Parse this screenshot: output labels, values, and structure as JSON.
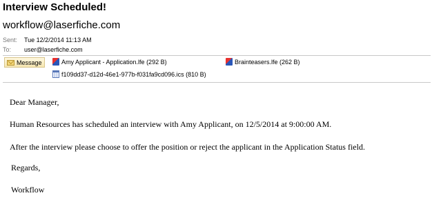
{
  "header": {
    "subject": "Interview Scheduled!",
    "sender": "workflow@laserfiche.com",
    "sent_label": "Sent:",
    "sent_value": "Tue 12/2/2014 11:13 AM",
    "to_label": "To:",
    "to_value": "user@laserfiche.com"
  },
  "attachments_bar": {
    "message_tab_label": "Message",
    "message_tab_icon": "envelope-icon",
    "items": [
      {
        "label": "Amy Applicant - Application.lfe (292 B)",
        "icon": "laserfiche-file-icon"
      },
      {
        "label": "Brainteasers.lfe (262 B)",
        "icon": "laserfiche-file-icon"
      },
      {
        "label": "f109dd37-d12d-46e1-977b-f031fa9cd096.ics (810 B)",
        "icon": "calendar-file-icon"
      }
    ]
  },
  "body": {
    "greeting": "Dear Manager,",
    "paragraph1": "Human Resources has scheduled an interview with Amy Applicant, on 12/5/2014 at 9:00:00 AM.",
    "paragraph2": "After the interview please choose to offer the position or reject the applicant in the Application Status field.",
    "closing": "Regards,",
    "signature": "Workflow"
  }
}
